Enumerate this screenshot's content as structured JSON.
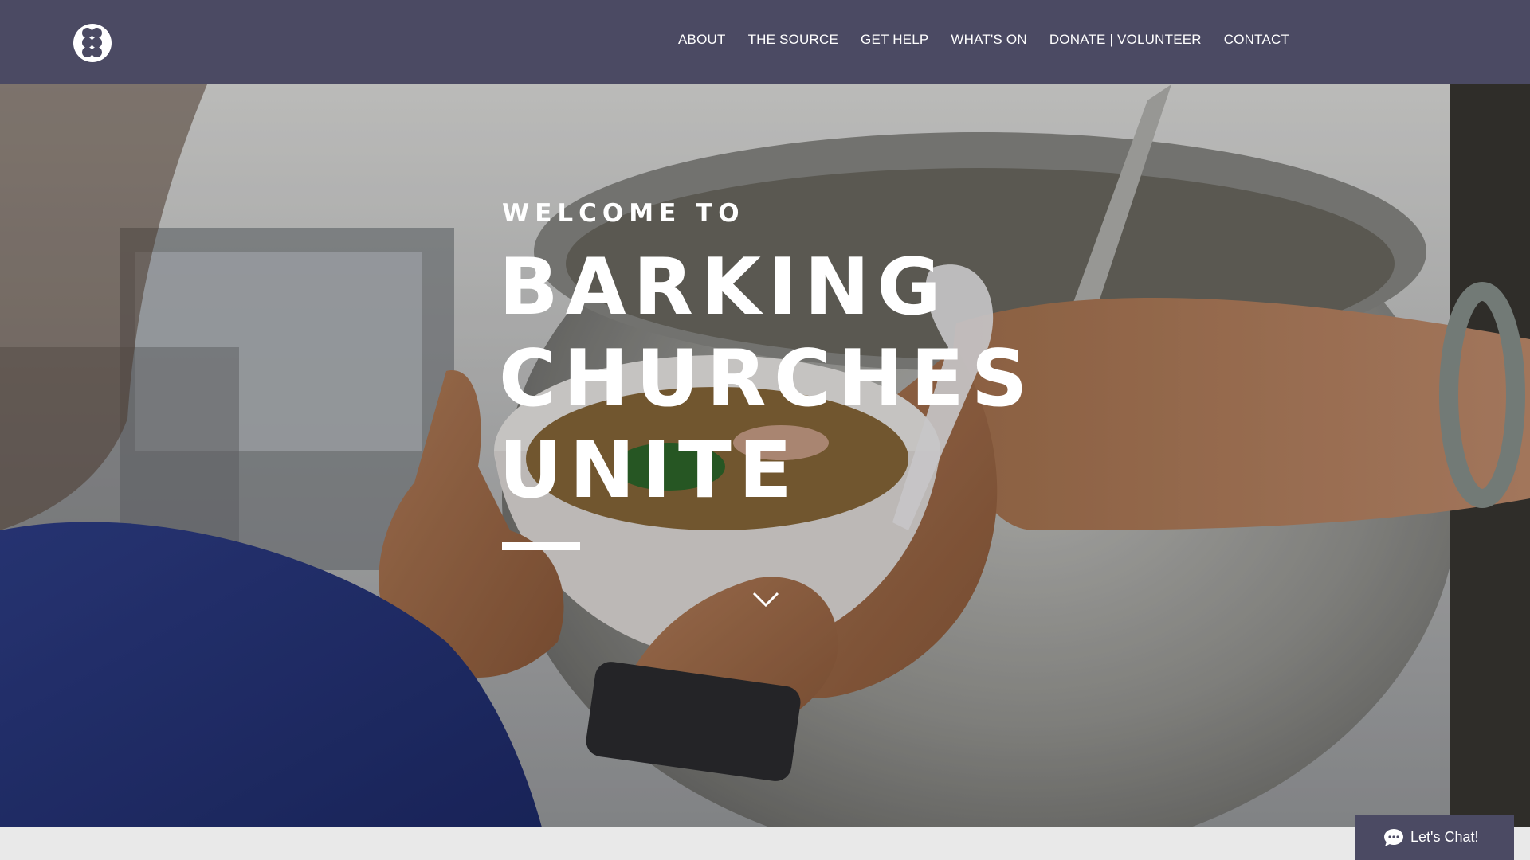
{
  "header": {
    "logo_icon": "dots-cluster-logo-icon",
    "nav_items": [
      "ABOUT",
      "THE SOURCE",
      "GET HELP",
      "WHAT'S ON",
      "DONATE | VOLUNTEER",
      "CONTACT"
    ]
  },
  "hero": {
    "welcome": "WELCOME TO",
    "title_lines": [
      "BARKING",
      "CHURCHES",
      "UNITE"
    ],
    "scroll_icon": "chevron-down-icon"
  },
  "chat": {
    "label": "Let's Chat!",
    "icon": "chat-bubble-icon"
  },
  "colors": {
    "header_bg": "#4b4a63",
    "text": "#ffffff",
    "footer_strip": "#e9e9e9"
  }
}
